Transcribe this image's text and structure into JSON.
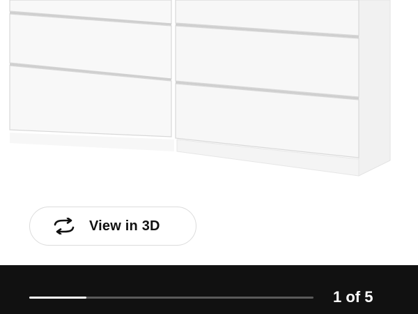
{
  "view3d": {
    "label": "View in 3D",
    "icon": "rotate-arrows-icon"
  },
  "gallery": {
    "counter_text": "1 of 5",
    "current_index": 1,
    "total": 5,
    "progress_fraction": 0.2,
    "product_image": "white six-drawer dresser"
  },
  "colors": {
    "bottom_bar": "#111111",
    "progress_fill": "#ffffff",
    "progress_track": "#5a5a5a"
  }
}
